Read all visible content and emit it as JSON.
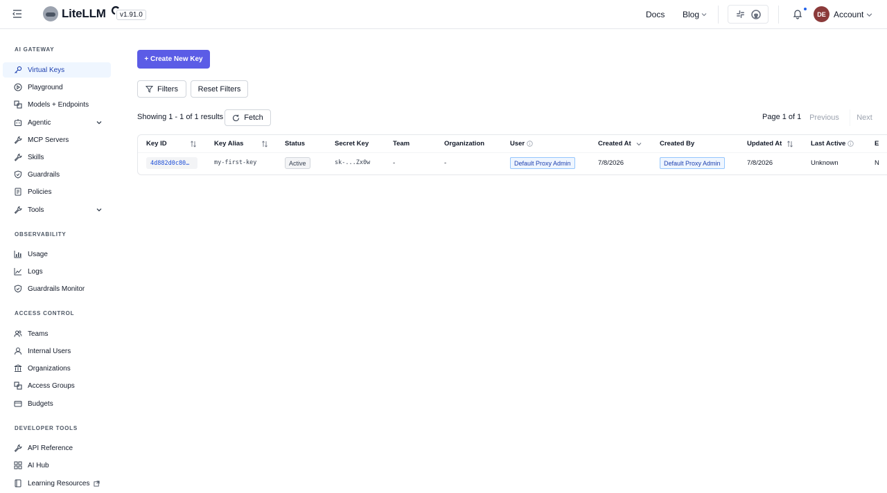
{
  "header": {
    "brand": "LiteLLM",
    "version": "v1.91.0",
    "nav_docs": "Docs",
    "nav_blog": "Blog",
    "avatar_initials": "DE",
    "account_label": "Account"
  },
  "sidebar": {
    "sections": {
      "ai_gateway": "AI GATEWAY",
      "observability": "OBSERVABILITY",
      "access_control": "ACCESS CONTROL",
      "developer_tools": "DEVELOPER TOOLS"
    },
    "items": {
      "virtual_keys": "Virtual Keys",
      "playground": "Playground",
      "models_endpoints": "Models + Endpoints",
      "agentic": "Agentic",
      "mcp_servers": "MCP Servers",
      "skills": "Skills",
      "guardrails": "Guardrails",
      "policies": "Policies",
      "tools": "Tools",
      "usage": "Usage",
      "logs": "Logs",
      "guardrails_monitor": "Guardrails Monitor",
      "teams": "Teams",
      "internal_users": "Internal Users",
      "organizations": "Organizations",
      "access_groups": "Access Groups",
      "budgets": "Budgets",
      "api_reference": "API Reference",
      "ai_hub": "AI Hub",
      "learning_resources": "Learning Resources"
    }
  },
  "main": {
    "create_button": "+ Create New Key",
    "filters_button": "Filters",
    "reset_filters_button": "Reset Filters",
    "showing_text": "Showing 1 - 1 of 1 results",
    "fetch_button": "Fetch",
    "page_info": "Page 1 of 1",
    "previous_button": "Previous",
    "next_button": "Next"
  },
  "table": {
    "columns": {
      "key_id": "Key ID",
      "key_alias": "Key Alias",
      "status": "Status",
      "secret_key": "Secret Key",
      "team": "Team",
      "organization": "Organization",
      "user": "User",
      "created_at": "Created At",
      "created_by": "Created By",
      "updated_at": "Updated At",
      "last_active": "Last Active",
      "expires": "E"
    },
    "row": {
      "key_id": "4d882d0c80…",
      "key_alias": "my-first-key",
      "status": "Active",
      "secret_key": "sk-...Zx0w",
      "team": "-",
      "organization": "-",
      "user": "Default Proxy Admin",
      "created_at": "7/8/2026",
      "created_by": "Default Proxy Admin",
      "updated_at": "7/8/2026",
      "last_active": "Unknown",
      "expires": "N"
    }
  },
  "colors": {
    "accent": "#5b5ce6",
    "active_nav_bg": "#eff6ff",
    "link_blue": "#1d4ed8"
  }
}
